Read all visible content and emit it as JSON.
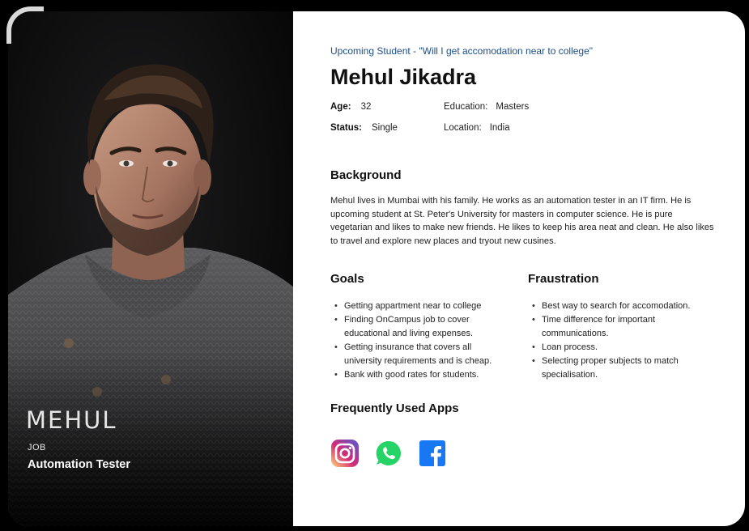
{
  "profile": {
    "tagline": "Upcoming Student - \"Will I get accomodation near to college\"",
    "name": "Mehul Jikadra",
    "photo_caption": "MEHUL",
    "job_label": "JOB",
    "job_value": "Automation Tester"
  },
  "details": {
    "age_label": "Age:",
    "age_value": "32",
    "education_label": "Education:",
    "education_value": "Masters",
    "status_label": "Status:",
    "status_value": "Single",
    "location_label": "Location:",
    "location_value": "India"
  },
  "background": {
    "heading": "Background",
    "text": "Mehul lives in Mumbai with his family. He works as an automation tester in an IT firm. He is upcoming student at St. Peter's University for masters in computer science. He is pure vegetarian and likes to make new friends. He likes to keep his area neat and clean. He also likes to travel and explore new places and tryout new cusines."
  },
  "goals": {
    "heading": "Goals",
    "items": [
      "Getting appartment near to college",
      "Finding OnCampus job to cover educational and living expenses.",
      "Getting insurance that covers all university requirements and is cheap.",
      "Bank with good rates for students."
    ]
  },
  "frustration": {
    "heading": "Fraustration",
    "items": [
      "Best way to search for accomodation.",
      "Time difference for important communications.",
      "Loan process.",
      "Selecting proper subjects to match specialisation."
    ]
  },
  "apps": {
    "heading": "Frequently Used Apps",
    "icons": [
      "instagram-icon",
      "whatsapp-icon",
      "facebook-icon"
    ],
    "colors": {
      "whatsapp": "#25d366",
      "facebook": "#1877f2",
      "instagram_a": "#feda75",
      "instagram_b": "#d62976",
      "instagram_c": "#4f5bd5"
    }
  },
  "colors": {
    "tagline": "#1e4e86",
    "frame_bg": "#ffffff",
    "page_bg": "#000000"
  }
}
